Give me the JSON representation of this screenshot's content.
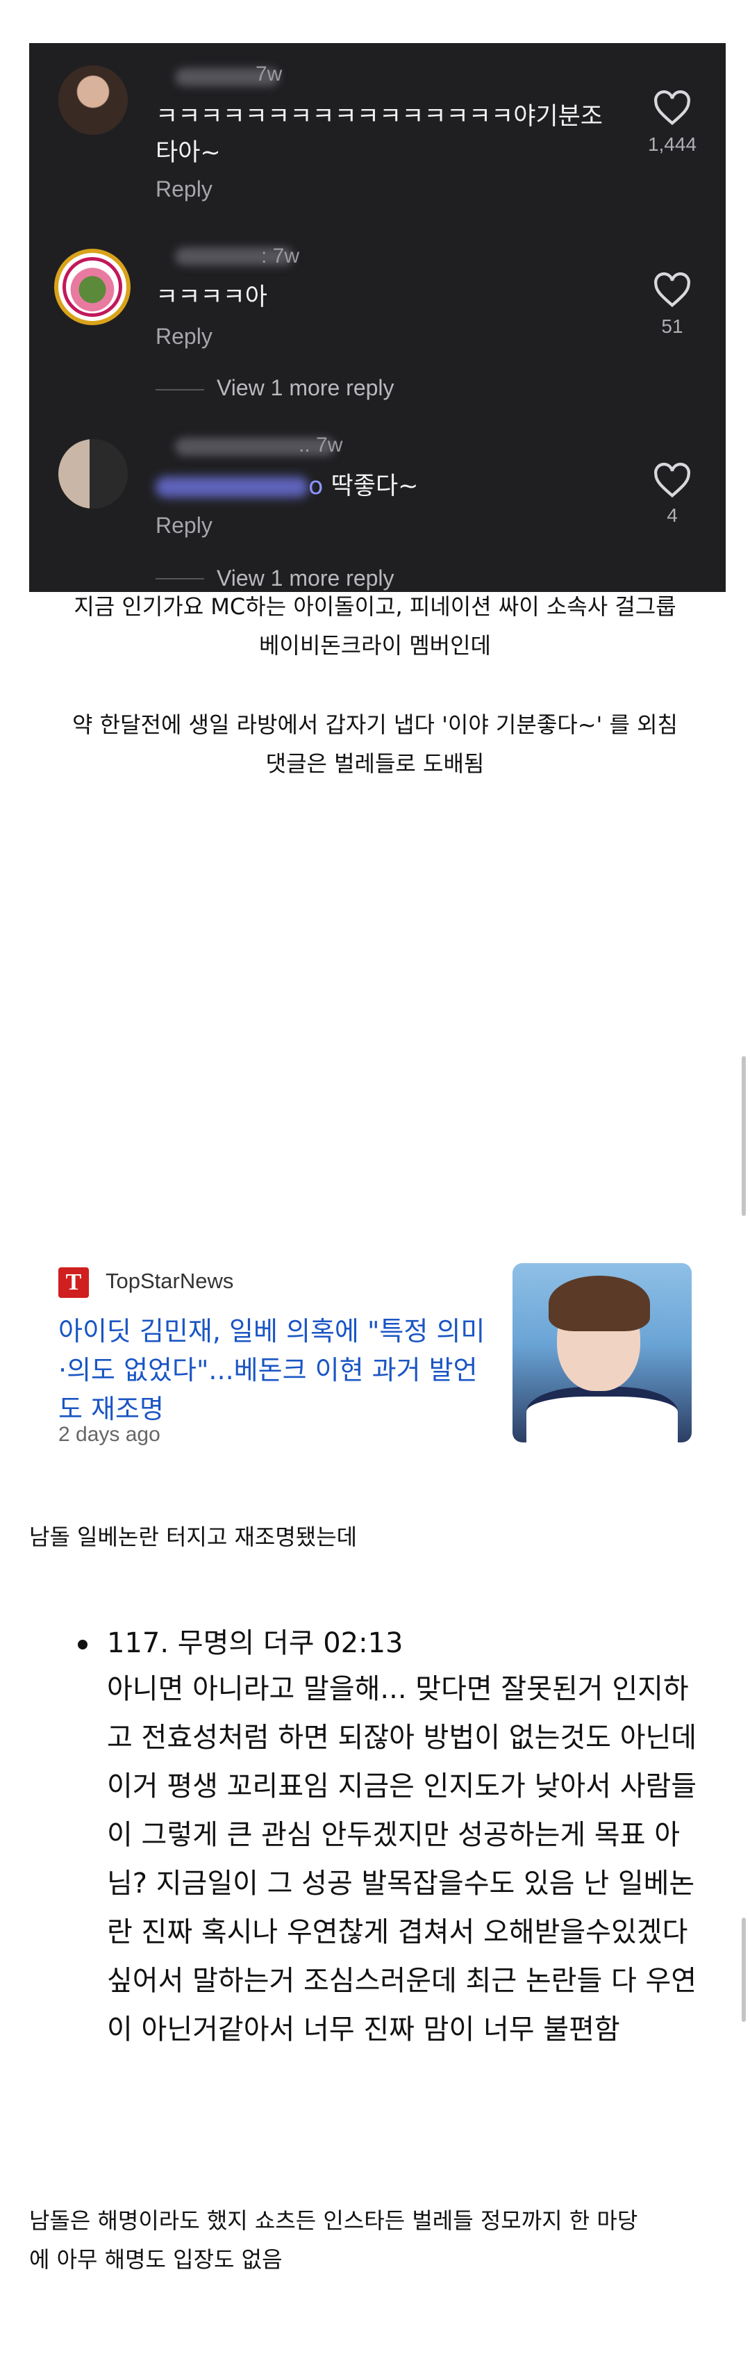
{
  "comments_screenshot": {
    "comments": [
      {
        "time": "7w",
        "text": "ㅋㅋㅋㅋㅋㅋㅋㅋㅋㅋㅋㅋㅋㅋㅋㅋ야기분조타아~",
        "reply": "Reply",
        "likes": "1,444"
      },
      {
        "time": ": 7w",
        "text": "ㅋㅋㅋㅋ아",
        "reply": "Reply",
        "likes": "51",
        "view_more": "View 1 more reply"
      },
      {
        "time": ".. 7w",
        "mention_tail": "o",
        "text": " 딱좋다~",
        "reply": "Reply",
        "likes": "4",
        "view_more": "View 1 more reply"
      }
    ]
  },
  "caption1": {
    "line1": "지금 인기가요 MC하는 아이돌이고, 피네이션 싸이 소속사 걸그룹",
    "line2": "베이비돈크라이 멤버인데"
  },
  "caption2": {
    "line1": "약 한달전에 생일 라방에서 갑자기 냅다 '이야 기분좋다~' 를 외침",
    "line2": "댓글은 벌레들로 도배됨"
  },
  "news": {
    "logo_letter": "T",
    "source": "TopStarNews",
    "title": "아이딧 김민재, 일베 의혹에 \"특정 의미·의도 없었다\"...베돈크 이현 과거 발언도 재조명",
    "age": "2 days ago"
  },
  "text1": "남돌 일베논란 터지고 재조명됐는데",
  "quote": {
    "header": "117. 무명의 더쿠 02:13",
    "body": "아니면 아니라고 말을해... 맞다면 잘못된거 인지하고 전효성처럼 하면 되잖아 방법이 없는것도 아닌데 이거 평생 꼬리표임 지금은 인지도가 낮아서 사람들이 그렇게 큰 관심 안두겠지만 성공하는게 목표 아님? 지금일이 그 성공 발목잡을수도 있음 난 일베논란 진짜 혹시나 우연찮게 겹쳐서 오해받을수있겠다 싶어서 말하는거 조심스러운데 최근 논란들 다 우연이 아닌거같아서 너무 진짜 맘이 너무 불편함"
  },
  "text2": {
    "line1": "남돌은 해명이라도 했지 쇼츠든 인스타든 벌레들 정모까지 한 마당",
    "line2": "에 아무 해명도 입장도 없음"
  },
  "icons": [
    "heart-icon",
    "topstarnews-logo"
  ]
}
